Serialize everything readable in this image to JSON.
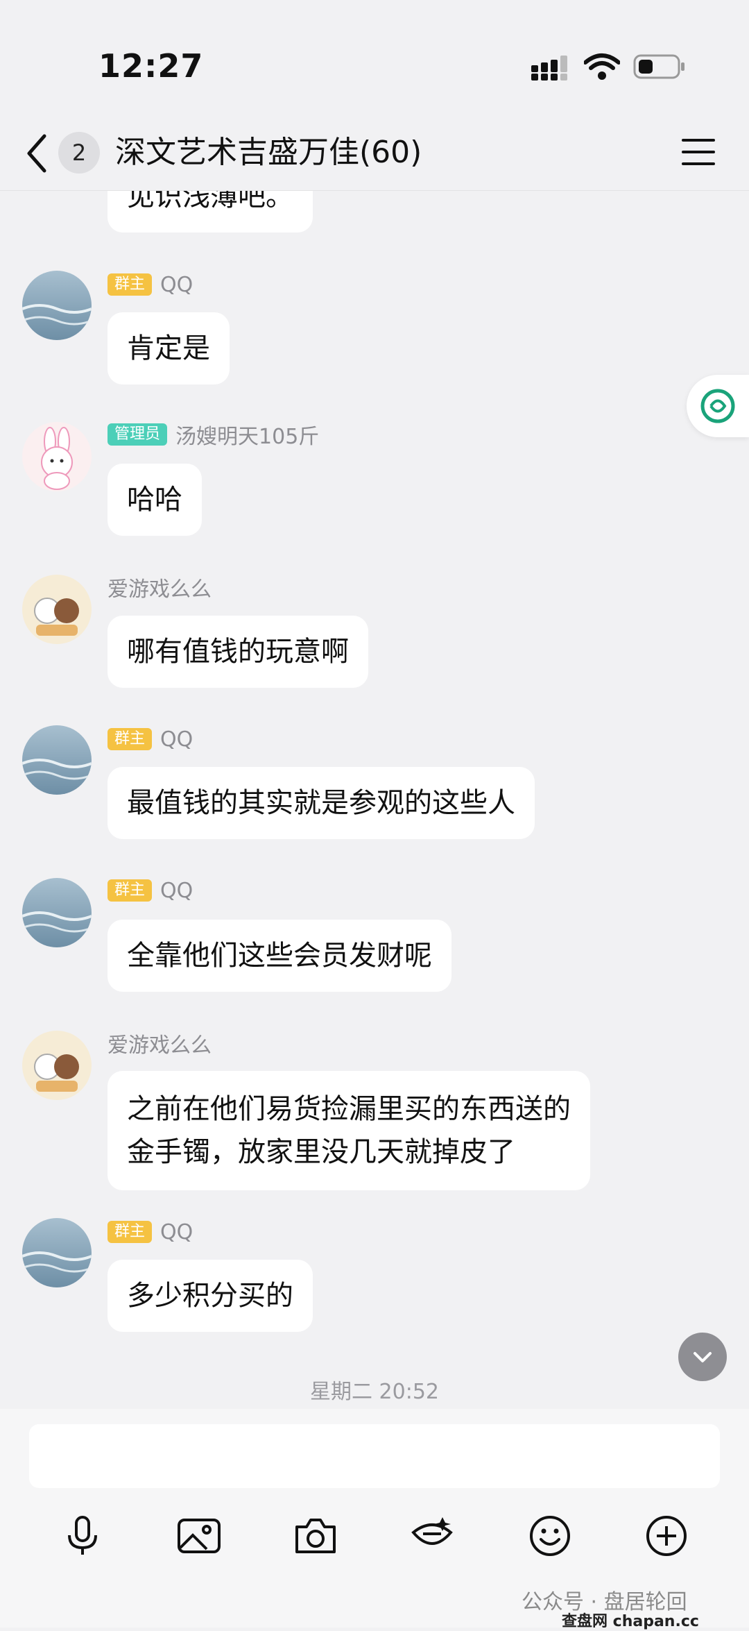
{
  "status": {
    "time": "12:27"
  },
  "header": {
    "unread": "2",
    "title": "深文艺术吉盛万佳(60)"
  },
  "messages": [
    {
      "name": "",
      "badge": "",
      "text": "见识浅薄吧。"
    },
    {
      "name": "QQ",
      "badge": "群主",
      "text": "肯定是"
    },
    {
      "name": "汤嫂明天105斤",
      "badge": "管理员",
      "text": "哈哈"
    },
    {
      "name": "爱游戏么么",
      "badge": "",
      "text": "哪有值钱的玩意啊"
    },
    {
      "name": "QQ",
      "badge": "群主",
      "text": "最值钱的其实就是参观的这些人"
    },
    {
      "name": "QQ",
      "badge": "群主",
      "text": "全靠他们这些会员发财呢"
    },
    {
      "name": "爱游戏么么",
      "badge": "",
      "text_line1": "之前在他们易货捡漏里买的东西送的",
      "text_line2": "金手镯，放家里没几天就掉皮了"
    },
    {
      "name": "QQ",
      "badge": "群主",
      "text": "多少积分买的"
    }
  ],
  "timestamp": "星期二 20:52",
  "watermark": "公众号 · 盘居轮回",
  "site": "查盘网 chapan.cc",
  "icons": [
    "back-icon",
    "menu-icon",
    "mic-icon",
    "image-icon",
    "camera-icon",
    "redpacket-icon",
    "emoji-icon",
    "plus-icon",
    "chevron-down-icon",
    "app-float-icon"
  ],
  "colors": {
    "owner_badge": "#f5c242",
    "admin_badge": "#4ccfb8",
    "bg": "#f1f1f3"
  }
}
